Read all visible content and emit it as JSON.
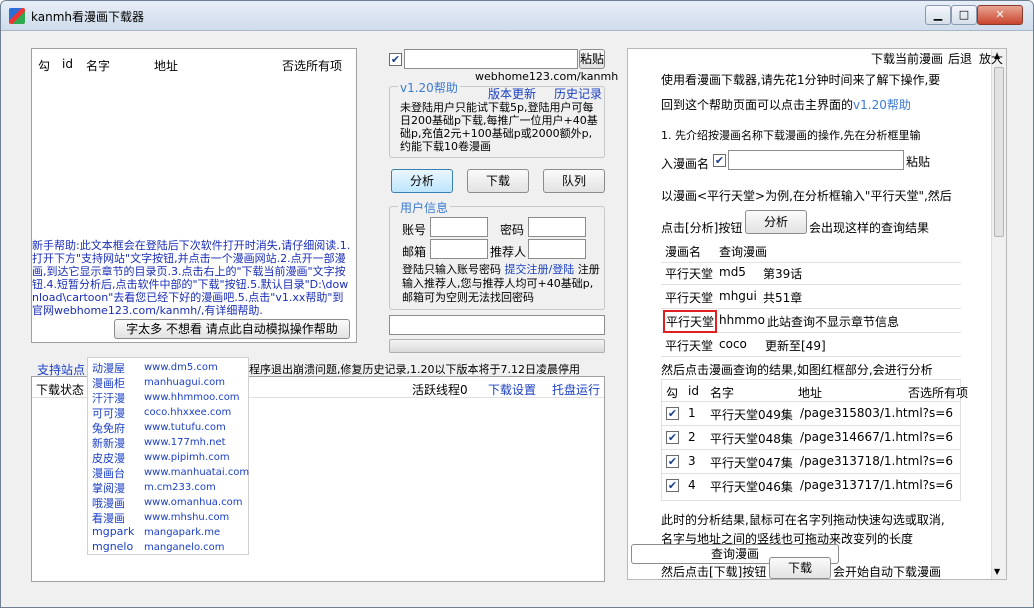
{
  "window": {
    "title": "kanmh看漫画下载器",
    "min": "▁",
    "max": "□",
    "close": "✕"
  },
  "list": {
    "headers": {
      "check": "勾",
      "id": "id",
      "name": "名字",
      "addr": "地址",
      "deselect": "否选所有项"
    },
    "help_text": "新手帮助:此文本框会在登陆后下次软件打开时消失,请仔细阅读.1.打开下方\"支持网站\"文字按钮,并点击一个漫画网站.2.点开一部漫画,到达它显示章节的目录页.3.点击右上的\"下载当前漫画\"文字按钮.4.短暂分析后,点击软件中部的\"下载\"按钮.5.默认目录\"D:\\download\\cartoon\"去看您已经下好的漫画吧.5.点击\"v1.xx帮助\"到官网webhome123.com/kanmh/,有详细帮助.",
    "auto_help_btn": "字太多 不想看 请点此自动模拟操作帮助"
  },
  "controls": {
    "paste_btn": "粘贴",
    "site_url": "webhome123.com/kanmh",
    "help_legend": "v1.20帮助",
    "version_update": "版本更新",
    "history": "历史记录",
    "notice": "未登陆用户只能试下载5p,登陆用户可每日200基础p下载,每推广一位用户+40基础p,充值2元+100基础p或2000额外p,约能下载10卷漫画",
    "analyze_btn": "分析",
    "download_btn": "下载",
    "queue_btn": "队列"
  },
  "user": {
    "legend": "用户信息",
    "account": "账号",
    "password": "密码",
    "email": "邮箱",
    "referrer": "推荐人",
    "tip_prefix": "登陆只输入账号密码",
    "tip_link": "提交注册/登陆",
    "tip_rest": "注册输入推荐人,您与推荐人均可+40基础p,邮箱可为空则无法找回密码"
  },
  "bottom": {
    "sites_label": "支持站点",
    "marquee": "程序退出崩溃问题,修复历史记录,1.20以下版本将于7.12日凌晨停用",
    "status_label": "下载状态",
    "threads": "活跃线程0",
    "settings": "下载设置",
    "tray": "托盘运行"
  },
  "sites": [
    {
      "name": "动漫屋",
      "url": "www.dm5.com"
    },
    {
      "name": "漫画柜",
      "url": "manhuagui.com"
    },
    {
      "name": "汗汗漫",
      "url": "www.hhmmoo.com"
    },
    {
      "name": "可可漫",
      "url": "coco.hhxxee.com"
    },
    {
      "name": "兔免府",
      "url": "www.tutufu.com"
    },
    {
      "name": "新新漫",
      "url": "www.177mh.net"
    },
    {
      "name": "皮皮漫",
      "url": "www.pipimh.com"
    },
    {
      "name": "漫画台",
      "url": "www.manhuatai.com"
    },
    {
      "name": "掌阅漫",
      "url": "m.cm233.com"
    },
    {
      "name": "哦漫画",
      "url": "www.omanhua.com"
    },
    {
      "name": "看漫画",
      "url": "www.mhshu.com"
    },
    {
      "name": "mgpark",
      "url": "mangapark.me"
    },
    {
      "name": "mgnelo",
      "url": "manganelo.com"
    }
  ],
  "right": {
    "top_links": {
      "download_current": "下载当前漫画",
      "back": "后退",
      "zoom": "放大"
    },
    "intro1": "使用看漫画下载器,请先花1分钟时间来了解下操作,要",
    "intro2_prefix": "回到这个帮助页面可以点击主界面的",
    "intro2_tag": "v1.20帮助",
    "step1": "1. 先介绍按漫画名称下载漫画的操作,先在分析框里输",
    "step1b_prefix": "入漫画名",
    "paste_btn": "粘贴",
    "example": "以漫画<平行天堂>为例,在分析框输入\"平行天堂\",然后",
    "click_prefix": "点击[分析]按钮",
    "analyze_btn": "分析",
    "click_suffix": "会出现这样的查询结果",
    "result_headers": {
      "name": "漫画名",
      "query": "查询漫画"
    },
    "results": [
      {
        "name": "平行天堂",
        "src": "md5",
        "info": "第39话"
      },
      {
        "name": "平行天堂",
        "src": "mhgui",
        "info": "共51章"
      },
      {
        "name": "平行天堂",
        "src": "hhmmo",
        "info": "此站查询不显示章节信息"
      },
      {
        "name": "平行天堂",
        "src": "coco",
        "info": "更新至[49]"
      }
    ],
    "then_text": "然后点击漫画查询的结果,如图红框部分,会进行分析",
    "chapter_headers": {
      "check": "勾",
      "id": "id",
      "name": "名字",
      "addr": "地址",
      "deselect": "否选所有项"
    },
    "chapters": [
      {
        "check": "✔",
        "id": "1",
        "name": "平行天堂049集",
        "addr": "/page315803/1.html?s=6"
      },
      {
        "check": "✔",
        "id": "2",
        "name": "平行天堂048集",
        "addr": "/page314667/1.html?s=6"
      },
      {
        "check": "✔",
        "id": "3",
        "name": "平行天堂047集",
        "addr": "/page313718/1.html?s=6"
      },
      {
        "check": "✔",
        "id": "4",
        "name": "平行天堂046集",
        "addr": "/page313717/1.html?s=6"
      }
    ],
    "note1": "此时的分析结果,鼠标可在名字列拖动快速勾选或取消,",
    "note2": "名字与地址之间的竖线也可拖动来改变列的长度",
    "query_manga_btn": "查询漫画",
    "final_prefix": "然后点击[下载]按钮",
    "download_btn": "下载",
    "final_suffix": "会开始自动下载漫画"
  }
}
